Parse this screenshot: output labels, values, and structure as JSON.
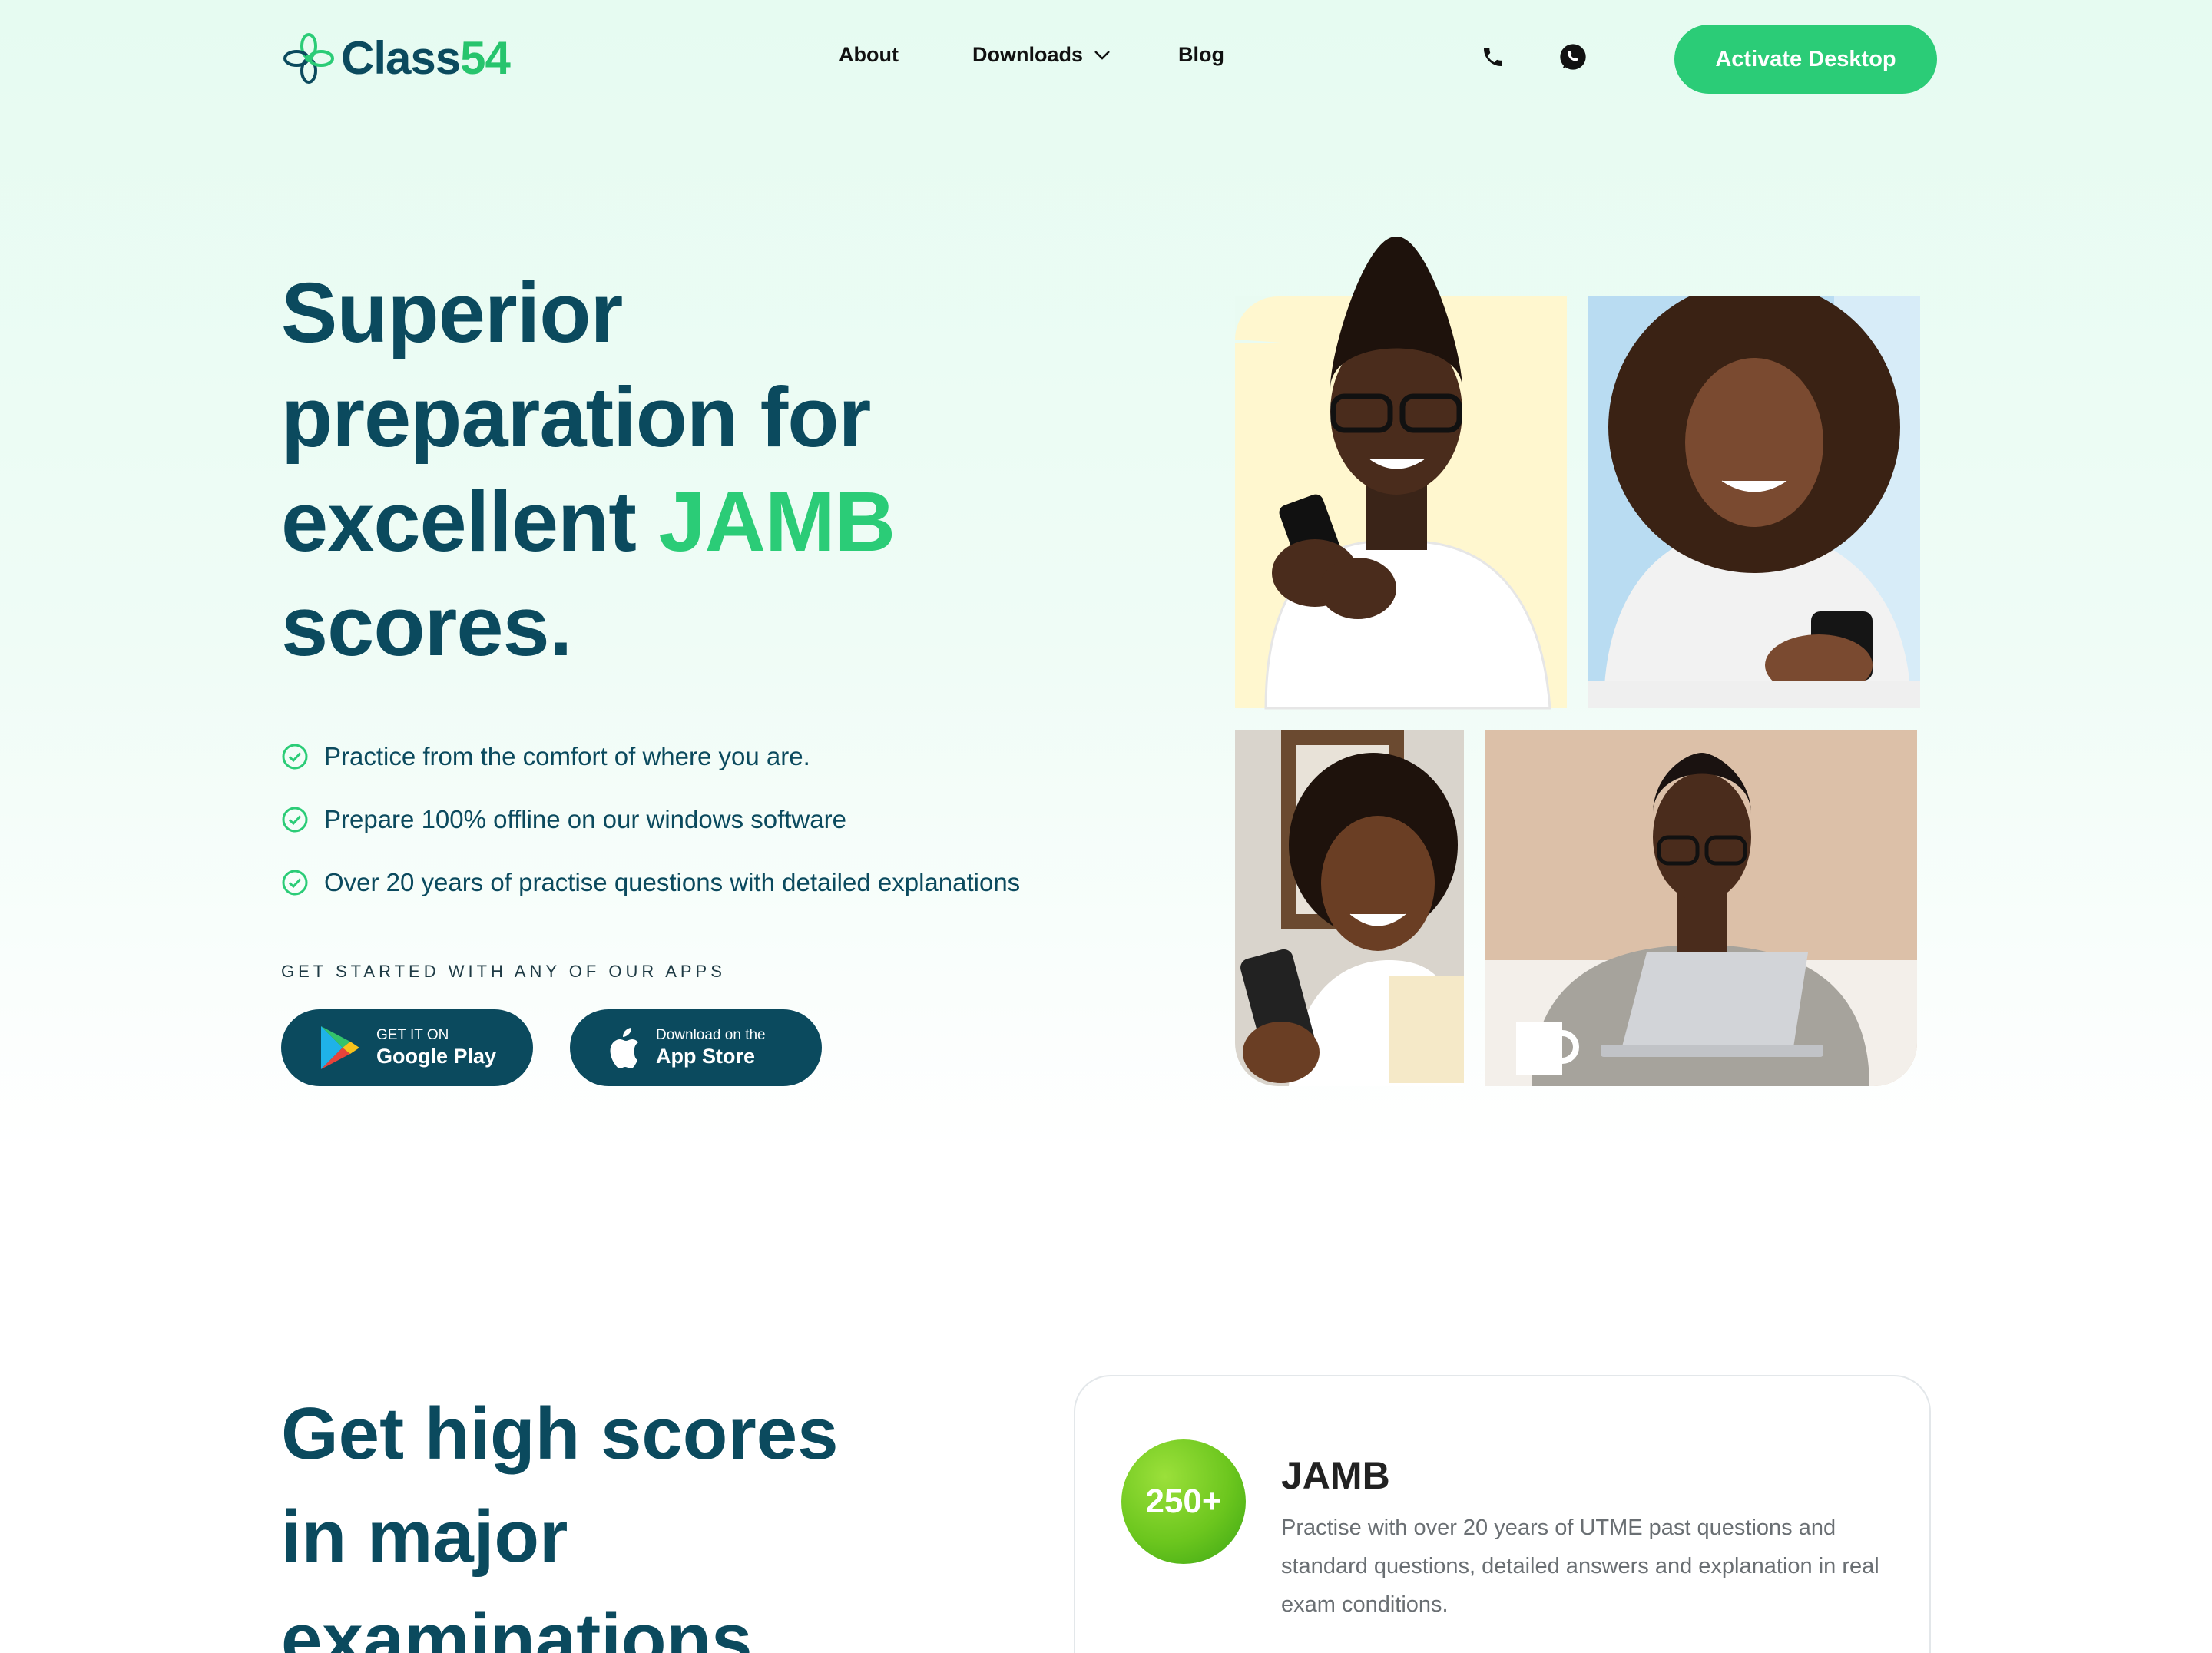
{
  "brand": {
    "name_part1": "Class",
    "name_part2": "54",
    "accent_color": "#2bcc77",
    "primary_color": "#0b4a5e"
  },
  "nav": {
    "links": [
      "About",
      "Downloads",
      "Blog"
    ],
    "icons": [
      "phone-icon",
      "whatsapp-icon"
    ],
    "cta_label": "Activate Desktop"
  },
  "hero": {
    "title_line1": "Superior",
    "title_line2": "preparation for",
    "title_line3_pre": "excellent ",
    "title_line3_accent": "JAMB",
    "title_line4": "scores.",
    "features": [
      "Practice from the comfort of where you are.",
      "Prepare 100% offline on our windows software",
      "Over 20 years of practise questions with detailed explanations"
    ],
    "apps_label": "GET STARTED WITH ANY OF OUR APPS",
    "google_play": {
      "small": "GET IT ON",
      "big": "Google Play"
    },
    "app_store": {
      "small": "Download on the",
      "big": "App Store"
    }
  },
  "section2": {
    "title_line1": "Get high scores",
    "title_line2": "in major",
    "title_line3": "examinations",
    "card": {
      "badge": "250+",
      "title": "JAMB",
      "description": "Practise with over 20 years of UTME past questions and standard questions, detailed answers and explanation in real exam conditions."
    }
  }
}
